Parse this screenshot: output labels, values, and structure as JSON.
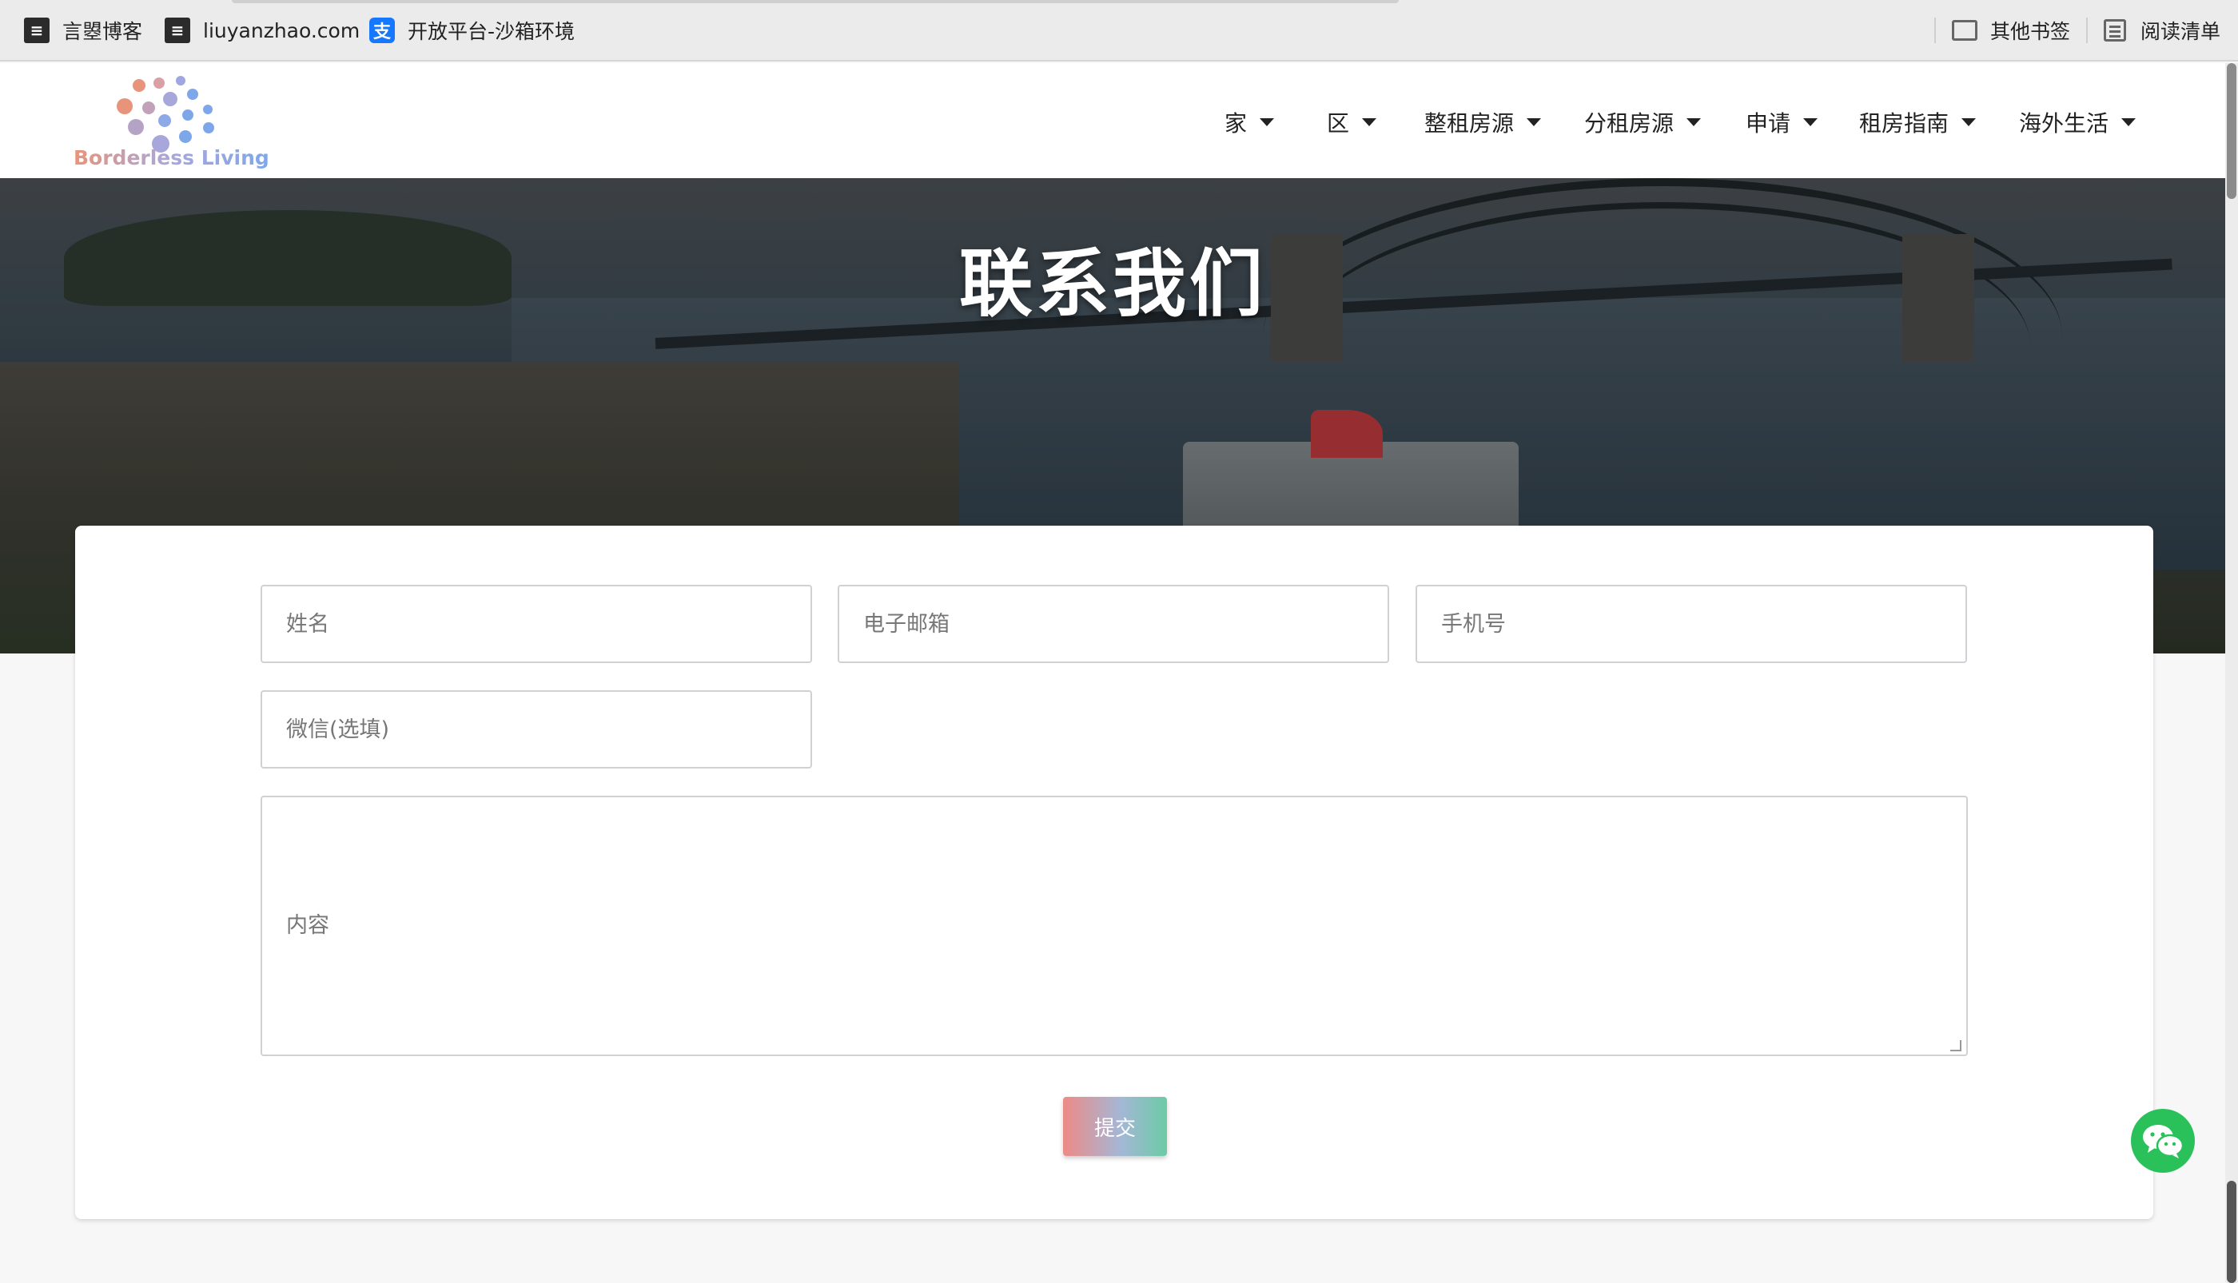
{
  "bookmarks": [
    {
      "label": "言曌博客",
      "icon": "doc-icon"
    },
    {
      "label": "liuyanzhao.com",
      "icon": "doc-icon"
    },
    {
      "label": "开放平台-沙箱环境",
      "icon": "alipay-icon"
    }
  ],
  "bookmarks_right": {
    "other": "其他书签",
    "reading_list": "阅读清单"
  },
  "logo": {
    "text": "Borderless Living"
  },
  "nav": [
    {
      "label": "家"
    },
    {
      "label": "区"
    },
    {
      "label": "整租房源"
    },
    {
      "label": "分租房源"
    },
    {
      "label": "申请"
    },
    {
      "label": "租房指南"
    },
    {
      "label": "海外生活"
    }
  ],
  "hero": {
    "title": "联系我们"
  },
  "form": {
    "name_placeholder": "姓名",
    "email_placeholder": "电子邮箱",
    "phone_placeholder": "手机号",
    "wechat_placeholder": "微信(选填)",
    "content_placeholder": "内容",
    "submit_label": "提交"
  },
  "colors": {
    "wechat_green": "#2bc15a",
    "submit_gradient_start": "#ee8a86",
    "submit_gradient_end": "#6ccaa6"
  }
}
